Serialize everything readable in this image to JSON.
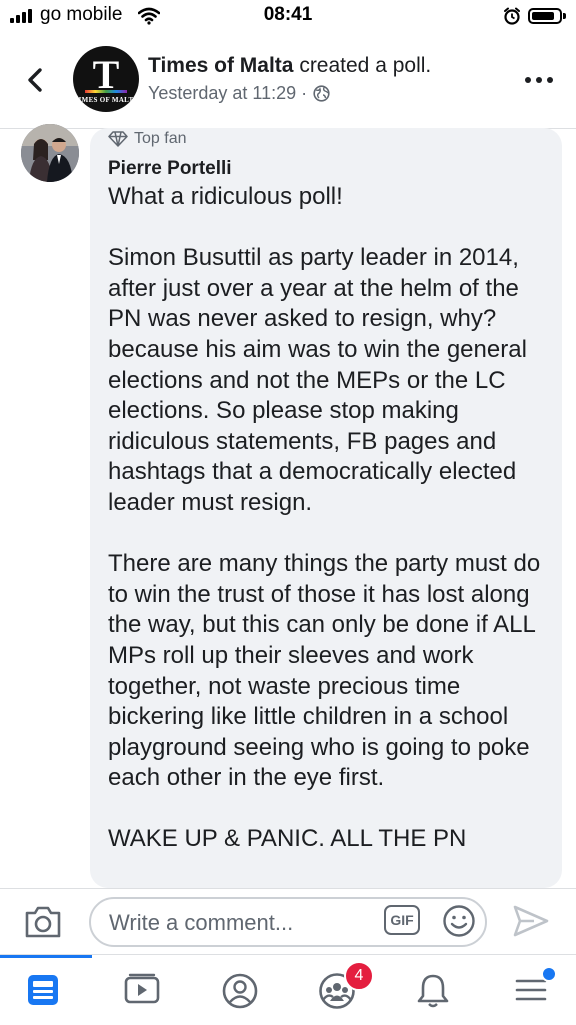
{
  "status_bar": {
    "carrier": "go mobile",
    "time": "08:41"
  },
  "header": {
    "page_name": "Times of Malta",
    "action": " created a poll.",
    "timestamp": "Yesterday at 11:29 ·",
    "avatar_letter": "T",
    "avatar_caption": "TIMES OF MALTA"
  },
  "comment": {
    "badge": "Top fan",
    "author": "Pierre Portelli",
    "text": "What a ridiculous poll!\n\nSimon Busuttil as party leader in 2014, after just over a year at the helm of the PN was never asked to resign, why? because his aim was to win the general elections and not the MEPs or the LC elections. So please stop making ridiculous statements, FB pages and hashtags that a democratically elected leader must resign.\n\nThere are many things the party must do to win the trust of those it has lost along the way, but this can only be done if ALL MPs roll up their sleeves and work together, not waste precious time bickering like little children in a school playground seeing who is going to poke each other in the eye first.\n\nWAKE UP & PANIC. ALL THE PN"
  },
  "composer": {
    "placeholder": "Write a comment...",
    "gif_label": "GIF"
  },
  "tabbar": {
    "groups_badge": "4",
    "tabs": [
      "news-feed",
      "watch",
      "profile",
      "groups",
      "notifications",
      "menu"
    ]
  },
  "colors": {
    "accent": "#1877f2",
    "badge": "#e41e3f",
    "bubble": "#f0f2f5",
    "icon_gray": "#606770"
  }
}
